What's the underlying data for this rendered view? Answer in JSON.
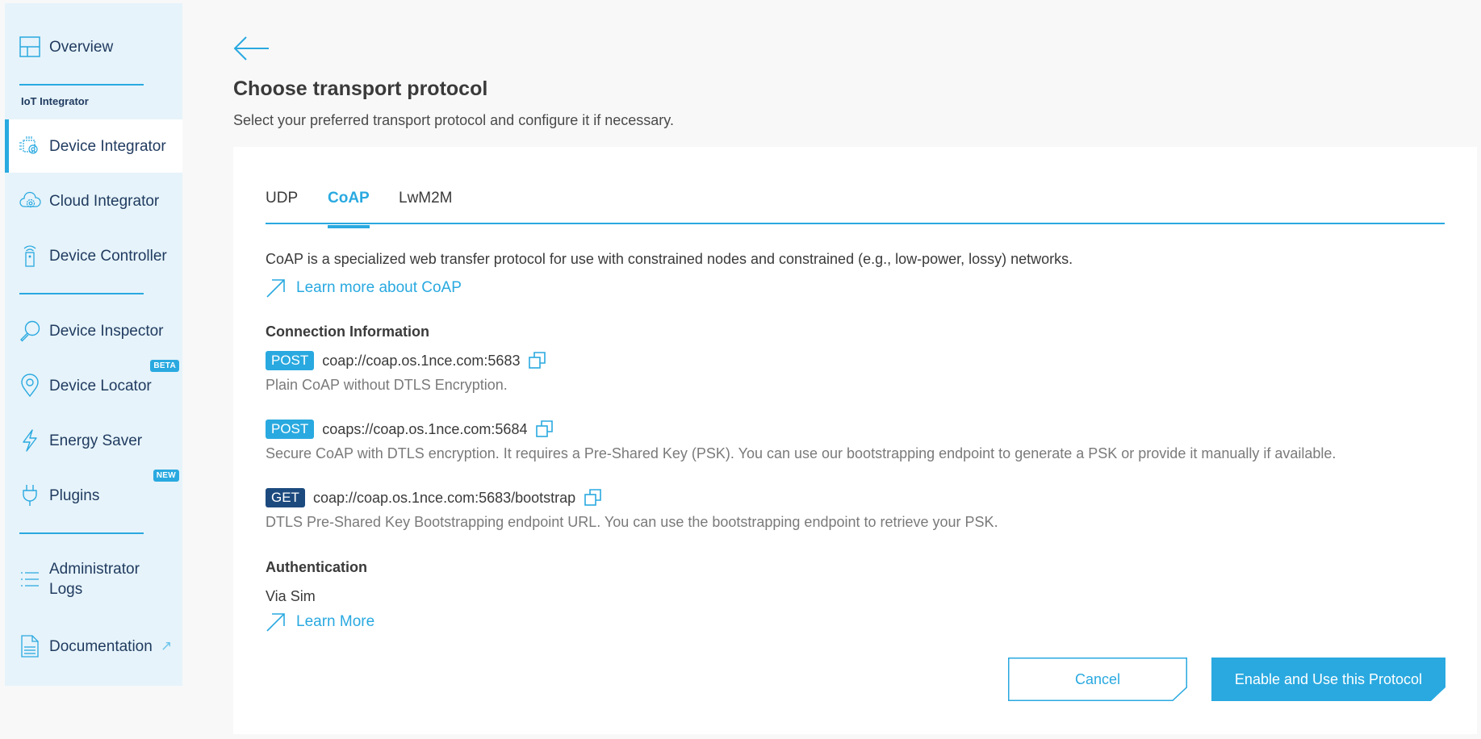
{
  "sidebar": {
    "section_label": "IoT Integrator",
    "items": [
      {
        "label": "Overview",
        "icon": "layout-icon"
      },
      {
        "label": "Device Integrator",
        "icon": "device-gear-icon",
        "active": true
      },
      {
        "label": "Cloud Integrator",
        "icon": "cloud-gear-icon"
      },
      {
        "label": "Device Controller",
        "icon": "remote-signal-icon"
      },
      {
        "label": "Device Inspector",
        "icon": "magnifier-icon"
      },
      {
        "label": "Device Locator",
        "icon": "location-pin-icon",
        "badge": "BETA"
      },
      {
        "label": "Energy Saver",
        "icon": "lightning-icon"
      },
      {
        "label": "Plugins",
        "icon": "plug-icon",
        "badge": "NEW"
      },
      {
        "label": "Administrator Logs",
        "label_line1": "Administrator",
        "label_line2": "Logs",
        "icon": "list-icon"
      },
      {
        "label": "Documentation",
        "icon": "document-icon",
        "external": "↗"
      }
    ]
  },
  "header": {
    "back_icon": "arrow-left-icon",
    "title": "Choose transport protocol",
    "subtitle": "Select your preferred transport protocol and configure it if necessary."
  },
  "tabs": [
    {
      "label": "UDP"
    },
    {
      "label": "CoAP",
      "active": true
    },
    {
      "label": "LwM2M"
    }
  ],
  "content": {
    "intro": "CoAP is a specialized web transfer protocol for use with constrained nodes and constrained (e.g., low-power, lossy) networks.",
    "learn_more_coap": "Learn more about CoAP",
    "connection_heading": "Connection Information",
    "endpoints": [
      {
        "method": "POST",
        "url": "coap://coap.os.1nce.com:5683",
        "description": "Plain CoAP without DTLS Encryption."
      },
      {
        "method": "POST",
        "url": "coaps://coap.os.1nce.com:5684",
        "description": "Secure CoAP with DTLS encryption. It requires a Pre-Shared Key (PSK). You can use our bootstrapping endpoint to generate a PSK or provide it manually if available."
      },
      {
        "method": "GET",
        "url": "coap://coap.os.1nce.com:5683/bootstrap",
        "description": "DTLS Pre-Shared Key Bootstrapping endpoint URL. You can use the bootstrapping endpoint to retrieve your PSK."
      }
    ],
    "auth_heading": "Authentication",
    "auth_value": "Via Sim",
    "learn_more": "Learn More"
  },
  "actions": {
    "cancel": "Cancel",
    "enable": "Enable and Use this Protocol"
  },
  "colors": {
    "accent": "#29a9e0",
    "get_method": "#1c4a7e",
    "sidebar_bg": "#e6f3fa"
  }
}
